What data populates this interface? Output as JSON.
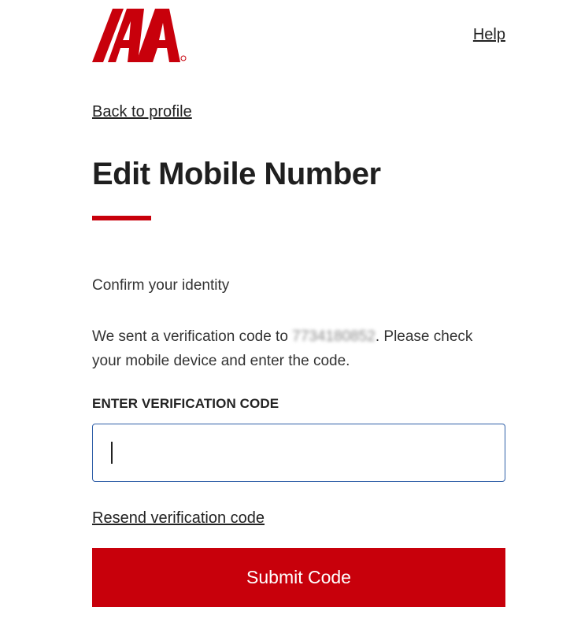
{
  "header": {
    "logo_text": "IAA",
    "help_label": "Help"
  },
  "nav": {
    "back_label": "Back to profile"
  },
  "page": {
    "title": "Edit Mobile Number",
    "subheading": "Confirm your identity",
    "message_prefix": "We sent a verification code to ",
    "phone_number": "7734180852",
    "message_suffix": ". Please check your mobile device and enter the code."
  },
  "form": {
    "code_label": "ENTER VERIFICATION CODE",
    "code_value": "",
    "resend_label": "Resend verification code",
    "submit_label": "Submit Code"
  },
  "colors": {
    "brand_red": "#c8000b",
    "input_border": "#2f5fa8"
  }
}
